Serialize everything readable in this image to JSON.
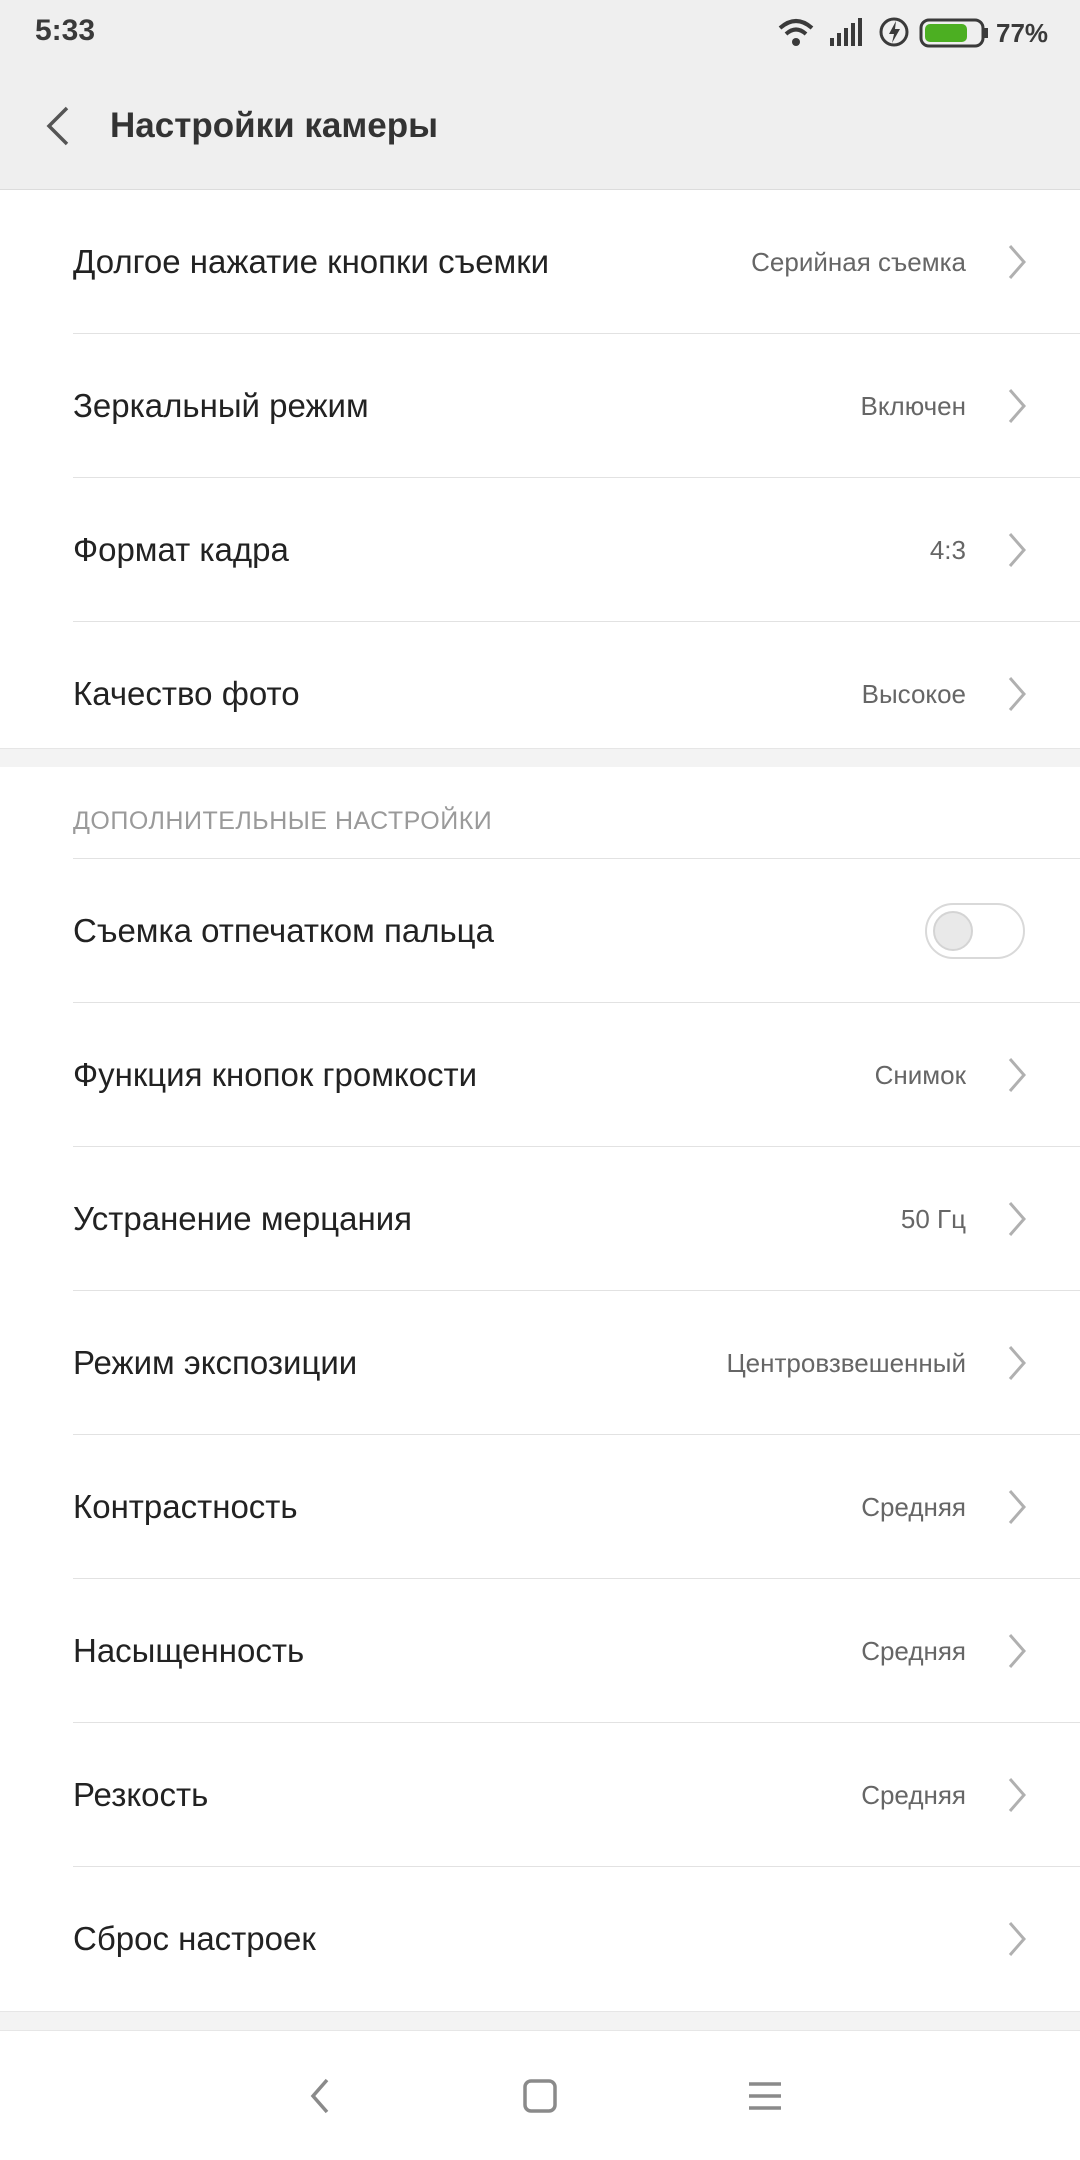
{
  "status_bar": {
    "time": "5:33",
    "battery_percent": "77%",
    "battery_level": 0.77,
    "icons": [
      "wifi-icon",
      "signal-icon",
      "charging-icon",
      "battery-icon"
    ]
  },
  "header": {
    "title": "Настройки камеры",
    "back_icon": "chevron-left-icon"
  },
  "main_settings": [
    {
      "label": "Долгое нажатие кнопки съемки",
      "value": "Серийная съемка"
    },
    {
      "label": "Зеркальный режим",
      "value": "Включен"
    },
    {
      "label": "Формат кадра",
      "value": "4:3"
    },
    {
      "label": "Качество фото",
      "value": "Высокое"
    }
  ],
  "advanced": {
    "header": "ДОПОЛНИТЕЛЬНЫЕ НАСТРОЙКИ",
    "fingerprint": {
      "label": "Съемка отпечатком пальца",
      "enabled": false
    },
    "items": [
      {
        "label": "Функция кнопок громкости",
        "value": "Снимок"
      },
      {
        "label": "Устранение мерцания",
        "value": "50 Гц"
      },
      {
        "label": "Режим экспозиции",
        "value": "Центровзвешенный"
      },
      {
        "label": "Контрастность",
        "value": "Средняя"
      },
      {
        "label": "Насыщенность",
        "value": "Средняя"
      },
      {
        "label": "Резкость",
        "value": "Средняя"
      },
      {
        "label": "Сброс настроек",
        "value": ""
      }
    ]
  },
  "nav_bar": {
    "icons": [
      "nav-back-icon",
      "nav-home-icon",
      "nav-menu-icon"
    ]
  },
  "colors": {
    "battery_green": "#4caf22",
    "background_gray": "#efefef",
    "text_primary": "#222222",
    "text_secondary": "#666666"
  }
}
